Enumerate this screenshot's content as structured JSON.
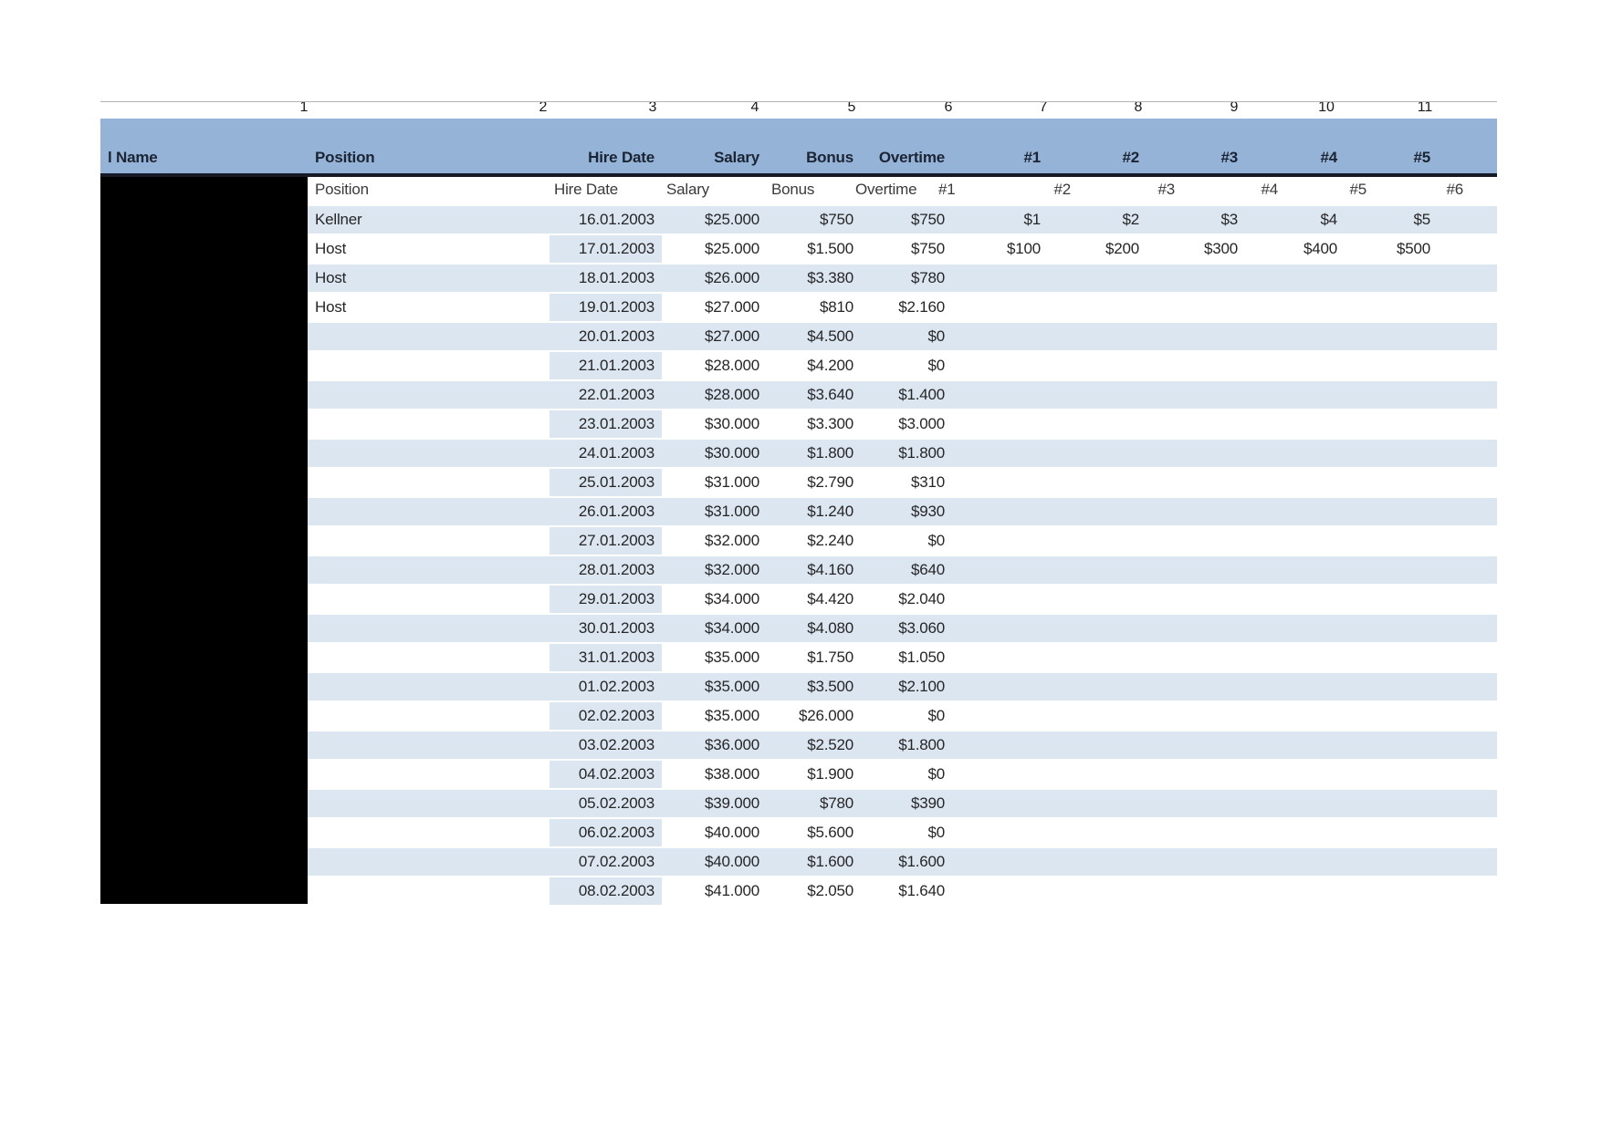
{
  "ruler": {
    "numbers": [
      "1",
      "2",
      "3",
      "4",
      "5",
      "6",
      "7",
      "8",
      "9",
      "10",
      "11"
    ]
  },
  "header": {
    "cells": [
      "l Name",
      "Position",
      "Hire Date",
      "Salary",
      "Bonus",
      "Overtime",
      "#1",
      "#2",
      "#3",
      "#4",
      "#5"
    ]
  },
  "repeat_header": {
    "cells": [
      "Position",
      "Hire Date",
      "Salary",
      "Bonus",
      "Overtime",
      "#1",
      "#2",
      "#3",
      "#4",
      "#5",
      "#6"
    ]
  },
  "rows": [
    {
      "position": "Kellner",
      "hire_date": "16.01.2003",
      "salary": "$25.000",
      "bonus": "$750",
      "overtime": "$750",
      "extras": [
        "$1",
        "$2",
        "$3",
        "$4",
        "$5"
      ]
    },
    {
      "position": "Host",
      "hire_date": "17.01.2003",
      "salary": "$25.000",
      "bonus": "$1.500",
      "overtime": "$750",
      "extras": [
        "$100",
        "$200",
        "$300",
        "$400",
        "$500"
      ]
    },
    {
      "position": "Host",
      "hire_date": "18.01.2003",
      "salary": "$26.000",
      "bonus": "$3.380",
      "overtime": "$780",
      "extras": []
    },
    {
      "position": "Host",
      "hire_date": "19.01.2003",
      "salary": "$27.000",
      "bonus": "$810",
      "overtime": "$2.160",
      "extras": []
    },
    {
      "position": "",
      "hire_date": "20.01.2003",
      "salary": "$27.000",
      "bonus": "$4.500",
      "overtime": "$0",
      "extras": []
    },
    {
      "position": "",
      "hire_date": "21.01.2003",
      "salary": "$28.000",
      "bonus": "$4.200",
      "overtime": "$0",
      "extras": []
    },
    {
      "position": "",
      "hire_date": "22.01.2003",
      "salary": "$28.000",
      "bonus": "$3.640",
      "overtime": "$1.400",
      "extras": []
    },
    {
      "position": "",
      "hire_date": "23.01.2003",
      "salary": "$30.000",
      "bonus": "$3.300",
      "overtime": "$3.000",
      "extras": []
    },
    {
      "position": "",
      "hire_date": "24.01.2003",
      "salary": "$30.000",
      "bonus": "$1.800",
      "overtime": "$1.800",
      "extras": []
    },
    {
      "position": "",
      "hire_date": "25.01.2003",
      "salary": "$31.000",
      "bonus": "$2.790",
      "overtime": "$310",
      "extras": []
    },
    {
      "position": "",
      "hire_date": "26.01.2003",
      "salary": "$31.000",
      "bonus": "$1.240",
      "overtime": "$930",
      "extras": []
    },
    {
      "position": "",
      "hire_date": "27.01.2003",
      "salary": "$32.000",
      "bonus": "$2.240",
      "overtime": "$0",
      "extras": []
    },
    {
      "position": "",
      "hire_date": "28.01.2003",
      "salary": "$32.000",
      "bonus": "$4.160",
      "overtime": "$640",
      "extras": []
    },
    {
      "position": "",
      "hire_date": "29.01.2003",
      "salary": "$34.000",
      "bonus": "$4.420",
      "overtime": "$2.040",
      "extras": []
    },
    {
      "position": "",
      "hire_date": "30.01.2003",
      "salary": "$34.000",
      "bonus": "$4.080",
      "overtime": "$3.060",
      "extras": []
    },
    {
      "position": "",
      "hire_date": "31.01.2003",
      "salary": "$35.000",
      "bonus": "$1.750",
      "overtime": "$1.050",
      "extras": []
    },
    {
      "position": "",
      "hire_date": "01.02.2003",
      "salary": "$35.000",
      "bonus": "$3.500",
      "overtime": "$2.100",
      "extras": []
    },
    {
      "position": "",
      "hire_date": "02.02.2003",
      "salary": "$35.000",
      "bonus": "$26.000",
      "overtime": "$0",
      "extras": []
    },
    {
      "position": "",
      "hire_date": "03.02.2003",
      "salary": "$36.000",
      "bonus": "$2.520",
      "overtime": "$1.800",
      "extras": []
    },
    {
      "position": "",
      "hire_date": "04.02.2003",
      "salary": "$38.000",
      "bonus": "$1.900",
      "overtime": "$0",
      "extras": []
    },
    {
      "position": "",
      "hire_date": "05.02.2003",
      "salary": "$39.000",
      "bonus": "$780",
      "overtime": "$390",
      "extras": []
    },
    {
      "position": "",
      "hire_date": "06.02.2003",
      "salary": "$40.000",
      "bonus": "$5.600",
      "overtime": "$0",
      "extras": []
    },
    {
      "position": "",
      "hire_date": "07.02.2003",
      "salary": "$40.000",
      "bonus": "$1.600",
      "overtime": "$1.600",
      "extras": []
    },
    {
      "position": "",
      "hire_date": "08.02.2003",
      "salary": "$41.000",
      "bonus": "$2.050",
      "overtime": "$1.640",
      "extras": []
    }
  ],
  "colors": {
    "header_bg": "#95b3d7",
    "row_stripe": "#dce6f1",
    "header_underline": "#151a24",
    "redaction": "#000000"
  }
}
